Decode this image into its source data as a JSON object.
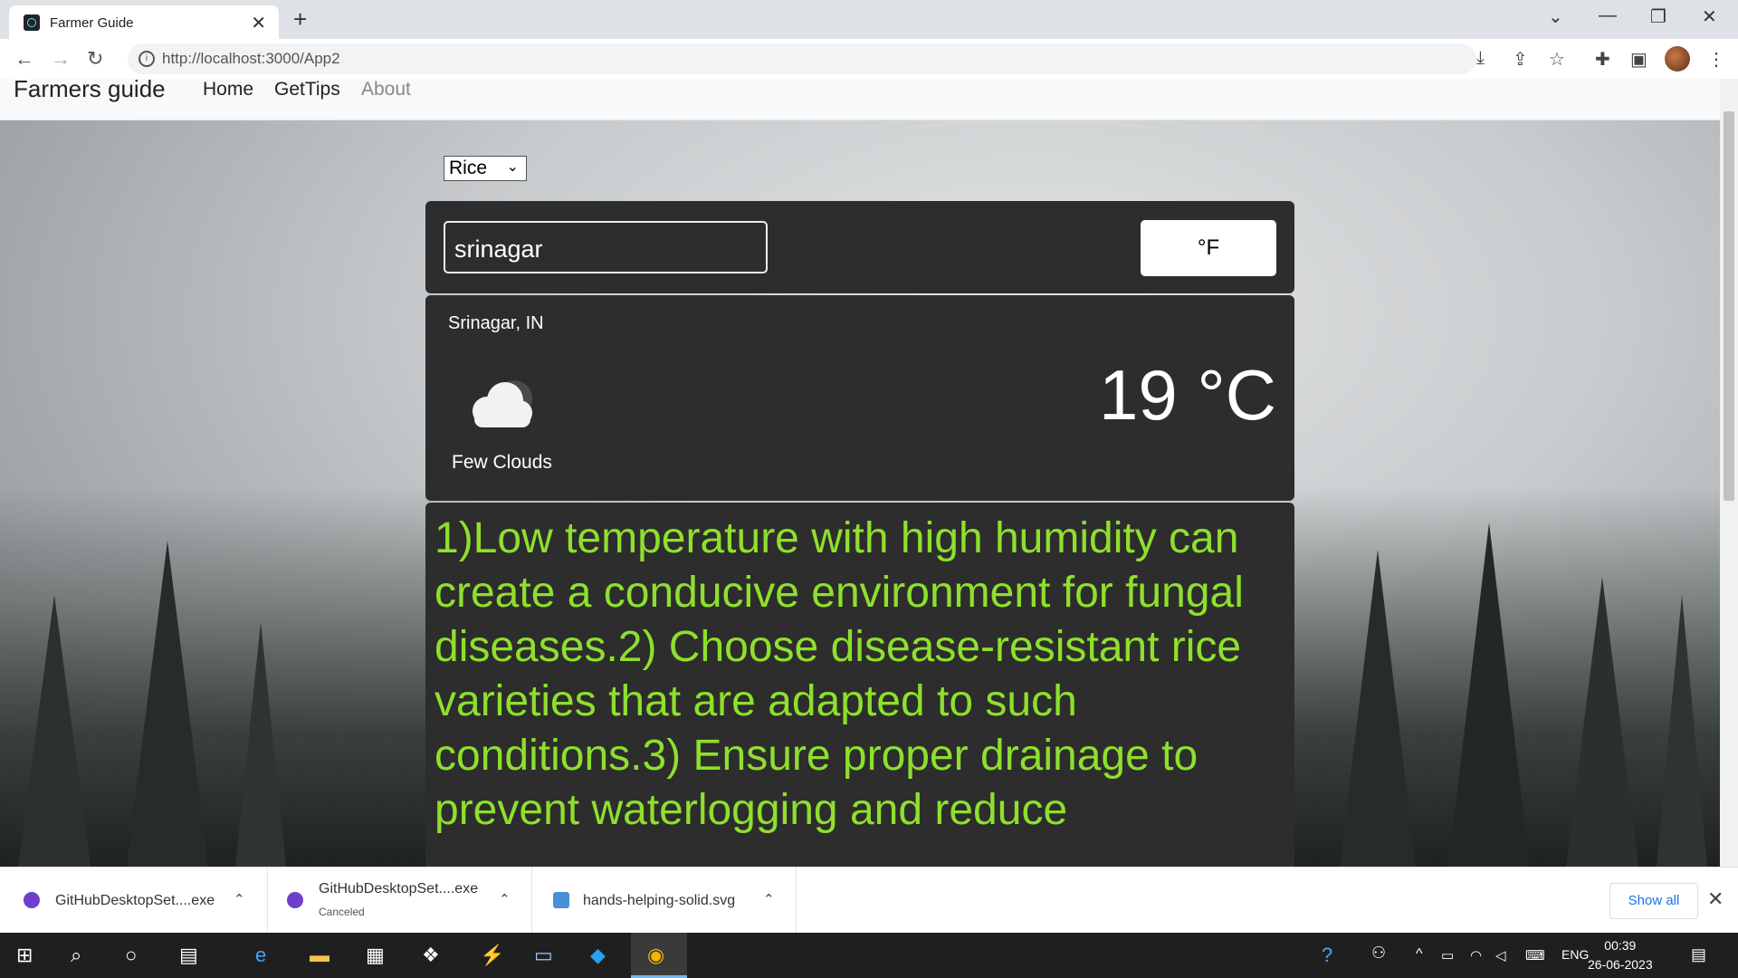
{
  "browser": {
    "tab_title": "Farmer Guide",
    "url": "http://localhost:3000/App2"
  },
  "navbar": {
    "brand": "Farmers guide",
    "links": [
      "Home",
      "GetTips",
      "About"
    ]
  },
  "crop_select": {
    "selected": "Rice"
  },
  "search": {
    "value": "srinagar"
  },
  "unit_toggle": {
    "label": "°F"
  },
  "weather": {
    "location": "Srinagar, IN",
    "description": "Few Clouds",
    "temperature": "19 °C",
    "icon": "cloud-icon"
  },
  "tips": {
    "text": "1)Low temperature with high humidity can create a conducive environment for fungal diseases.2) Choose disease-resistant rice varieties that are adapted to such conditions.3) Ensure proper drainage to prevent waterlogging and reduce"
  },
  "downloads": {
    "items": [
      {
        "name": "GitHubDesktopSet....exe",
        "status": ""
      },
      {
        "name": "GitHubDesktopSet....exe",
        "status": "Canceled"
      },
      {
        "name": "hands-helping-solid.svg",
        "status": ""
      }
    ],
    "show_all": "Show all"
  },
  "taskbar": {
    "language": "ENG",
    "time": "00:39",
    "date": "26-06-2023"
  },
  "colors": {
    "tip_text": "#8ee02c",
    "panel_bg": "#2d2d2d"
  }
}
